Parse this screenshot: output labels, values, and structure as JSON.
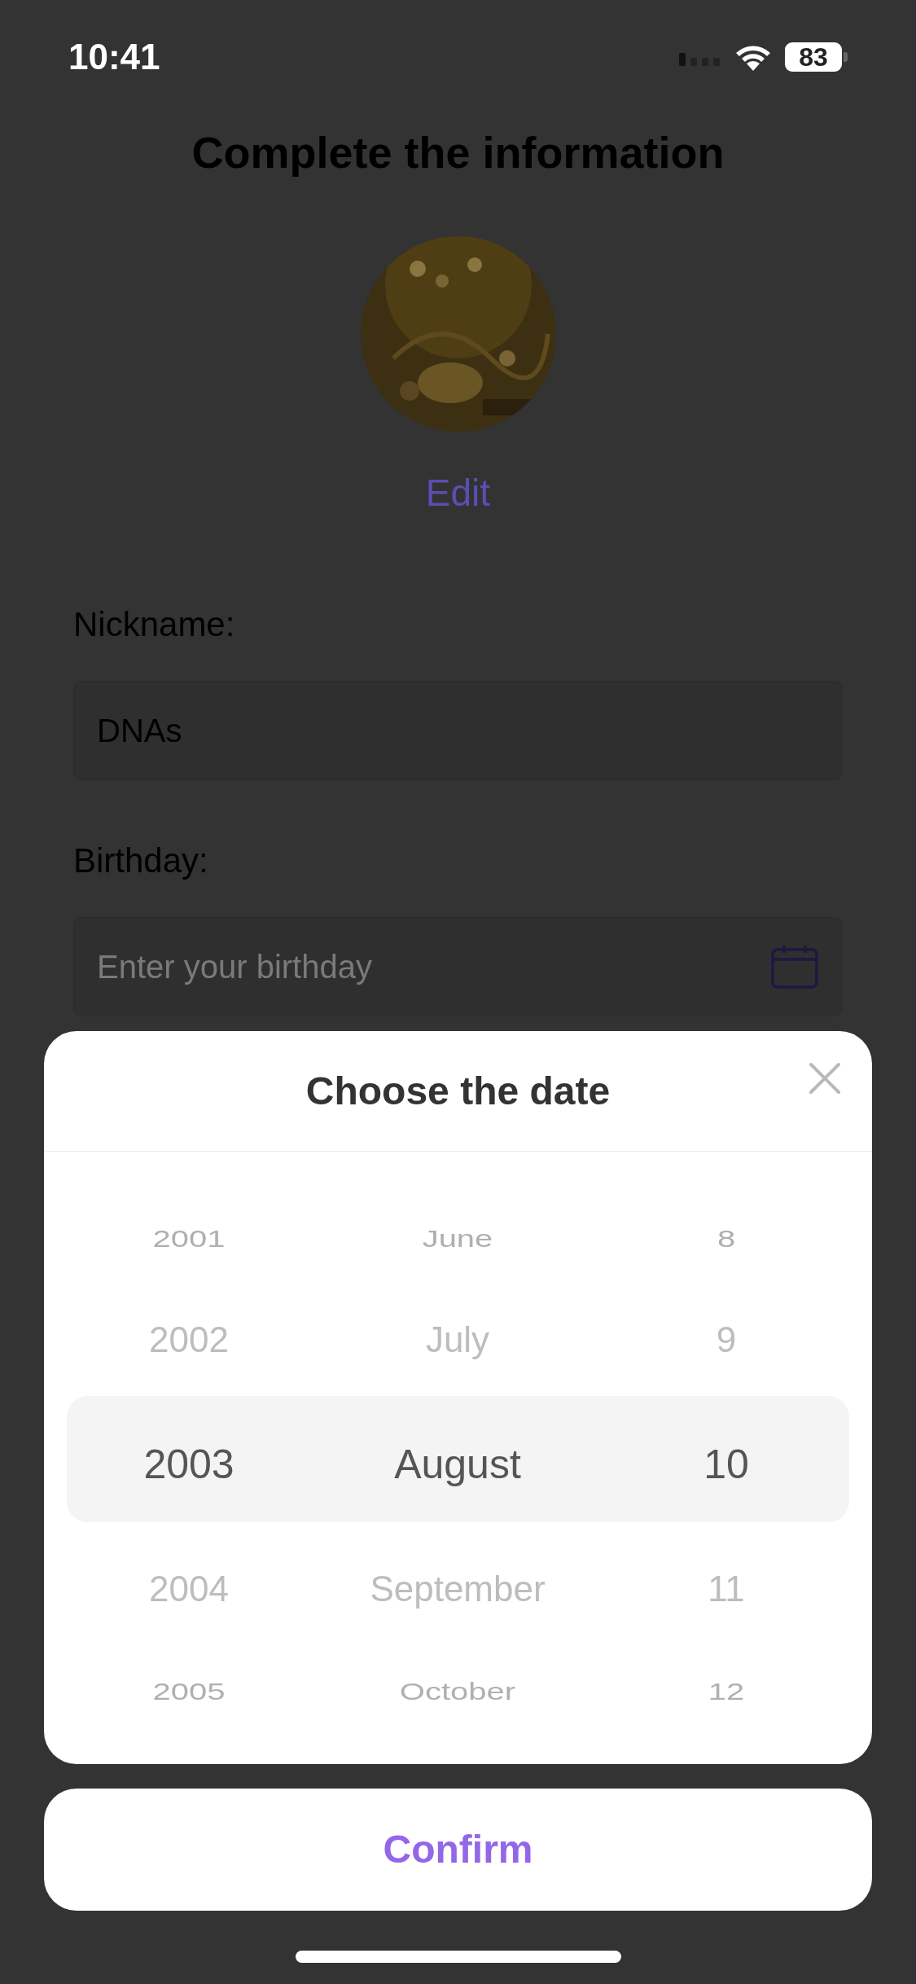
{
  "status_bar": {
    "time": "10:41",
    "battery": "83"
  },
  "page": {
    "title": "Complete the information",
    "edit_link": "Edit",
    "fields": [
      {
        "label": "Nickname:",
        "value": "DNAs"
      },
      {
        "label": "Birthday:",
        "placeholder": "Enter your birthday",
        "kind": "date"
      }
    ]
  },
  "date_sheet": {
    "title": "Choose the date",
    "columns": [
      {
        "items": [
          {
            "label": "2001",
            "selected": false
          },
          {
            "label": "2002",
            "selected": false
          },
          {
            "label": "2003",
            "selected": true
          },
          {
            "label": "2004",
            "selected": false
          },
          {
            "label": "2005",
            "selected": false
          }
        ]
      },
      {
        "items": [
          {
            "label": "June",
            "selected": false
          },
          {
            "label": "July",
            "selected": false
          },
          {
            "label": "August",
            "selected": true
          },
          {
            "label": "September",
            "selected": false
          },
          {
            "label": "October",
            "selected": false
          }
        ]
      },
      {
        "items": [
          {
            "label": "8",
            "selected": false
          },
          {
            "label": "9",
            "selected": false
          },
          {
            "label": "10",
            "selected": true
          },
          {
            "label": "11",
            "selected": false
          },
          {
            "label": "12",
            "selected": false
          }
        ]
      }
    ]
  },
  "confirm_button": "Confirm"
}
